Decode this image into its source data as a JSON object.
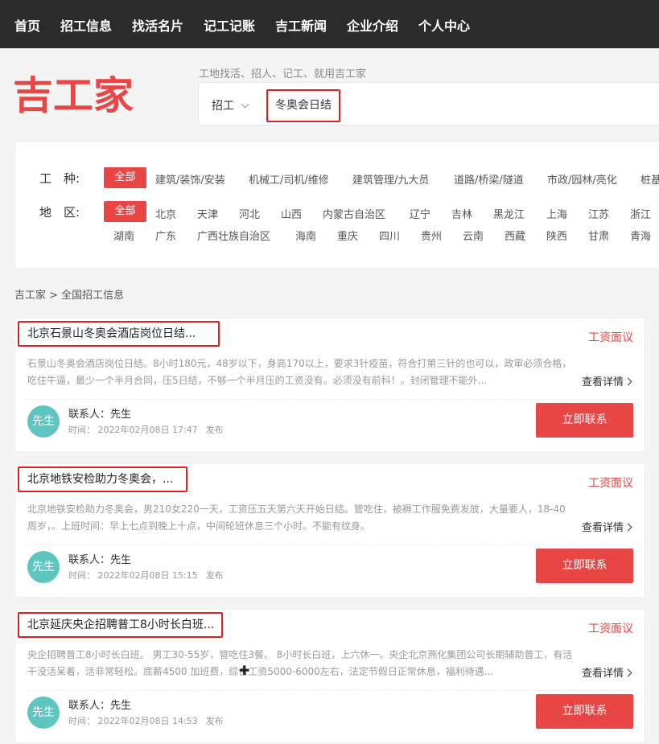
{
  "nav": [
    "首页",
    "招工信息",
    "找活名片",
    "记工记账",
    "吉工新闻",
    "企业介绍",
    "个人中心"
  ],
  "logo_text": "吉工家",
  "slogan": "工地找活、招人、记工、就用吉工家",
  "search": {
    "type": "招工",
    "value": "冬奥会日结"
  },
  "filter": {
    "trade_label": "工　种:",
    "region_label": "地　区:",
    "all_label": "全部",
    "trades": [
      "建筑/装饰/安装",
      "机械工/司机/维修",
      "建筑管理/九大员",
      "道路/桥梁/隧道",
      "市政/园林/亮化",
      "桩基"
    ],
    "regions_row1": [
      "北京",
      "天津",
      "河北",
      "山西",
      "内蒙古自治区",
      "辽宁",
      "吉林",
      "黑龙江",
      "上海",
      "江苏",
      "浙江"
    ],
    "regions_row2": [
      "湖南",
      "广东",
      "广西壮族自治区",
      "海南",
      "重庆",
      "四川",
      "贵州",
      "云南",
      "西藏",
      "陕西",
      "甘肃",
      "青海"
    ]
  },
  "breadcrumb": "吉工家 > 全国招工信息",
  "jobs": [
    {
      "title": "北京石景山冬奥会酒店岗位日结...",
      "wage": "工资面议",
      "desc": "石景山冬奥会酒店岗位日结。8小时180元，48岁以下，身高170以上，要求3针疫苗，符合打第三针的也可以，政审必须合格，吃住牛逼，最少一个半月合同，压5日结，不够一个半月压的工资没有。必须没有前科！。封闭管理不能外...",
      "detail": "查看详情",
      "avatar": "先生",
      "contact": "联系人：先生",
      "time": "时间：  2022年02月08日 17:47",
      "publish": "发布",
      "button": "立即联系"
    },
    {
      "title": "北京地铁安检助力冬奥会，...",
      "wage": "工资面议",
      "desc": "北京地铁安检助力冬奥会，男210女220一天，工资压五天第六天开始日结。管吃住，被褥工作服免费发放，大量要人，18-40周岁，。上班时间：早上七点到晚上十点，中间轮班休息三个小时。不能有纹身。",
      "detail": "查看详情",
      "avatar": "先生",
      "contact": "联系人：先生",
      "time": "时间：  2022年02月08日 15:15",
      "publish": "发布",
      "button": "立即联系"
    },
    {
      "title": "北京延庆央企招聘普工8小时长白班...",
      "wage": "工资面议",
      "desc": "央企招聘普工8小时长白班。 男工30-55岁，管吃住3餐。 8小时长白班，上六休一。央企北京燕化集团公司长期辅助普工，有活干没活呆着，活非常轻松。底薪4500  加班费，综合工资5000-6000左右，法定节假日正常休息，福利待遇...",
      "detail": "查看详情",
      "avatar": "先生",
      "contact": "联系人：先生",
      "time": "时间：  2022年02月08日 14:53",
      "publish": "发布",
      "button": "立即联系"
    }
  ],
  "colors": {
    "nav_bg": "#2b2b2b",
    "accent": "#e84545",
    "highlight_border": "#e01f1f",
    "avatar": "#5ec5c0"
  }
}
